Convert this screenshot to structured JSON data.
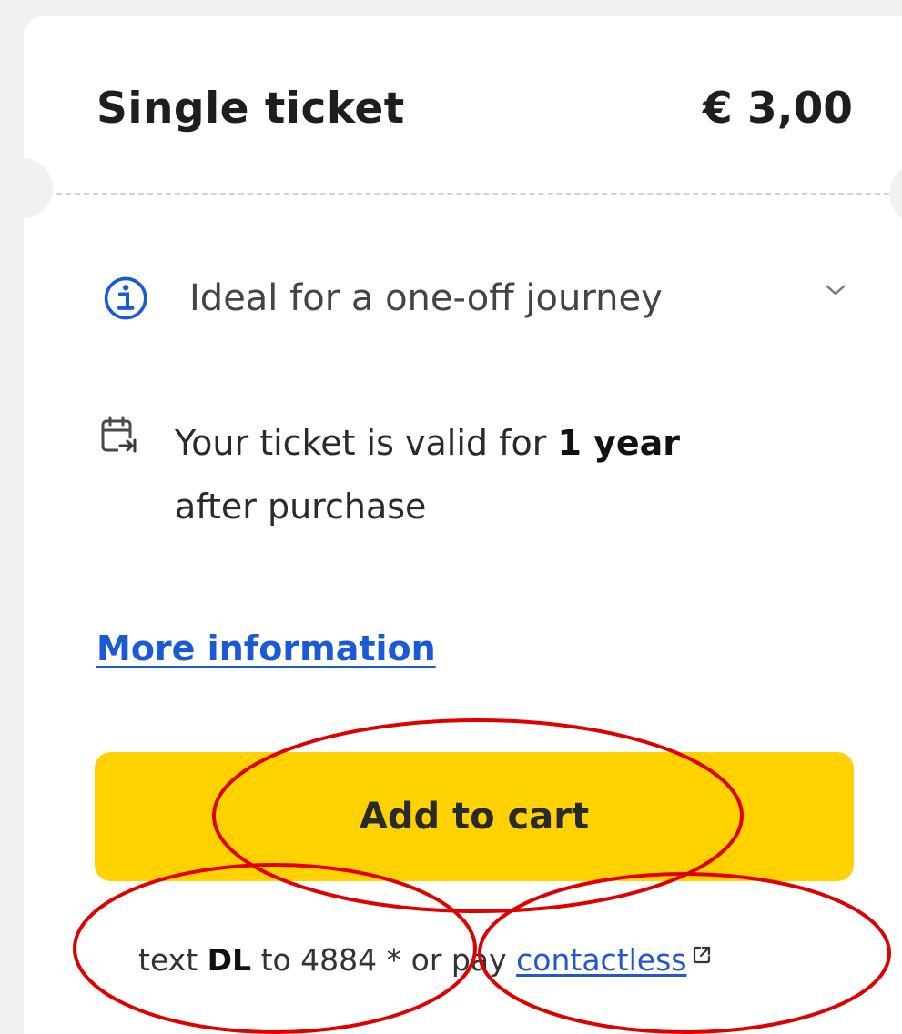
{
  "ticket": {
    "title": "Single ticket",
    "price": "€ 3,00"
  },
  "info": {
    "text": "Ideal for a one-off journey"
  },
  "validity": {
    "prefix": "Your ticket is valid for",
    "duration": "1 year",
    "suffix": "after purchase"
  },
  "links": {
    "more_information": "More information"
  },
  "cart": {
    "button_label": "Add to cart"
  },
  "sms": {
    "text_word": "text",
    "keyword": "DL",
    "to_number": "to 4884",
    "asterisk": "*",
    "or_pay": "or pay",
    "contactless": "contactless"
  },
  "colors": {
    "button_yellow": "#ffd200",
    "link_blue": "#1a5ad6",
    "annotation_red": "#e00000"
  },
  "icons": {
    "info": "info-icon",
    "chevron": "chevron-down-icon",
    "calendar": "calendar-icon",
    "external": "external-link-icon"
  }
}
